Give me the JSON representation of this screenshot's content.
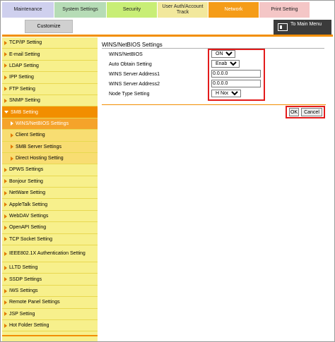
{
  "tabs": {
    "maintenance": "Maintenance",
    "system_settings": "System Settings",
    "security": "Security",
    "user_auth": "User Auth/Account Track",
    "network": "Network",
    "print_setting": "Print Setting"
  },
  "toolbar": {
    "customize": "Customize",
    "to_main_menu": "To Main Menu"
  },
  "sidebar": {
    "items": [
      "TCP/IP Setting",
      "E-mail Setting",
      "LDAP Setting",
      "IPP Setting",
      "FTP Setting",
      "SNMP Setting",
      "SMB Setting",
      "WINS/NetBIOS Settings",
      "Client Setting",
      "SMB Server Settings",
      "Direct Hosting Setting",
      "DPWS Settings",
      "Bonjour Setting",
      "NetWare Setting",
      "AppleTalk Setting",
      "WebDAV Settings",
      "OpenAPI Setting",
      "TCP Socket Setting",
      "IEEE802.1X Authentication Setting",
      "LLTD Setting",
      "SSDP Settings",
      "IWS Settings",
      "Remote Panel Settings",
      "JSP Setting",
      "Hot Folder Setting"
    ]
  },
  "content": {
    "title": "WINS/NetBIOS Settings",
    "fields": {
      "wins_netbios": {
        "label": "WINS/NetBIOS",
        "value": "ON"
      },
      "auto_obtain": {
        "label": "Auto Obtain Setting",
        "value": "Enable"
      },
      "wins_server1": {
        "label": "WINS Server Address1",
        "value": "0.0.0.0"
      },
      "wins_server2": {
        "label": "WINS Server Address2",
        "value": "0.0.0.0"
      },
      "node_type": {
        "label": "Node Type Setting",
        "value": "H Node"
      }
    },
    "ok_label": "OK",
    "cancel_label": "Cancel"
  },
  "colors": {
    "accent": "#f28e00",
    "highlight_box": "#e31b1b",
    "sidebar_bg": "#f7f08c"
  }
}
